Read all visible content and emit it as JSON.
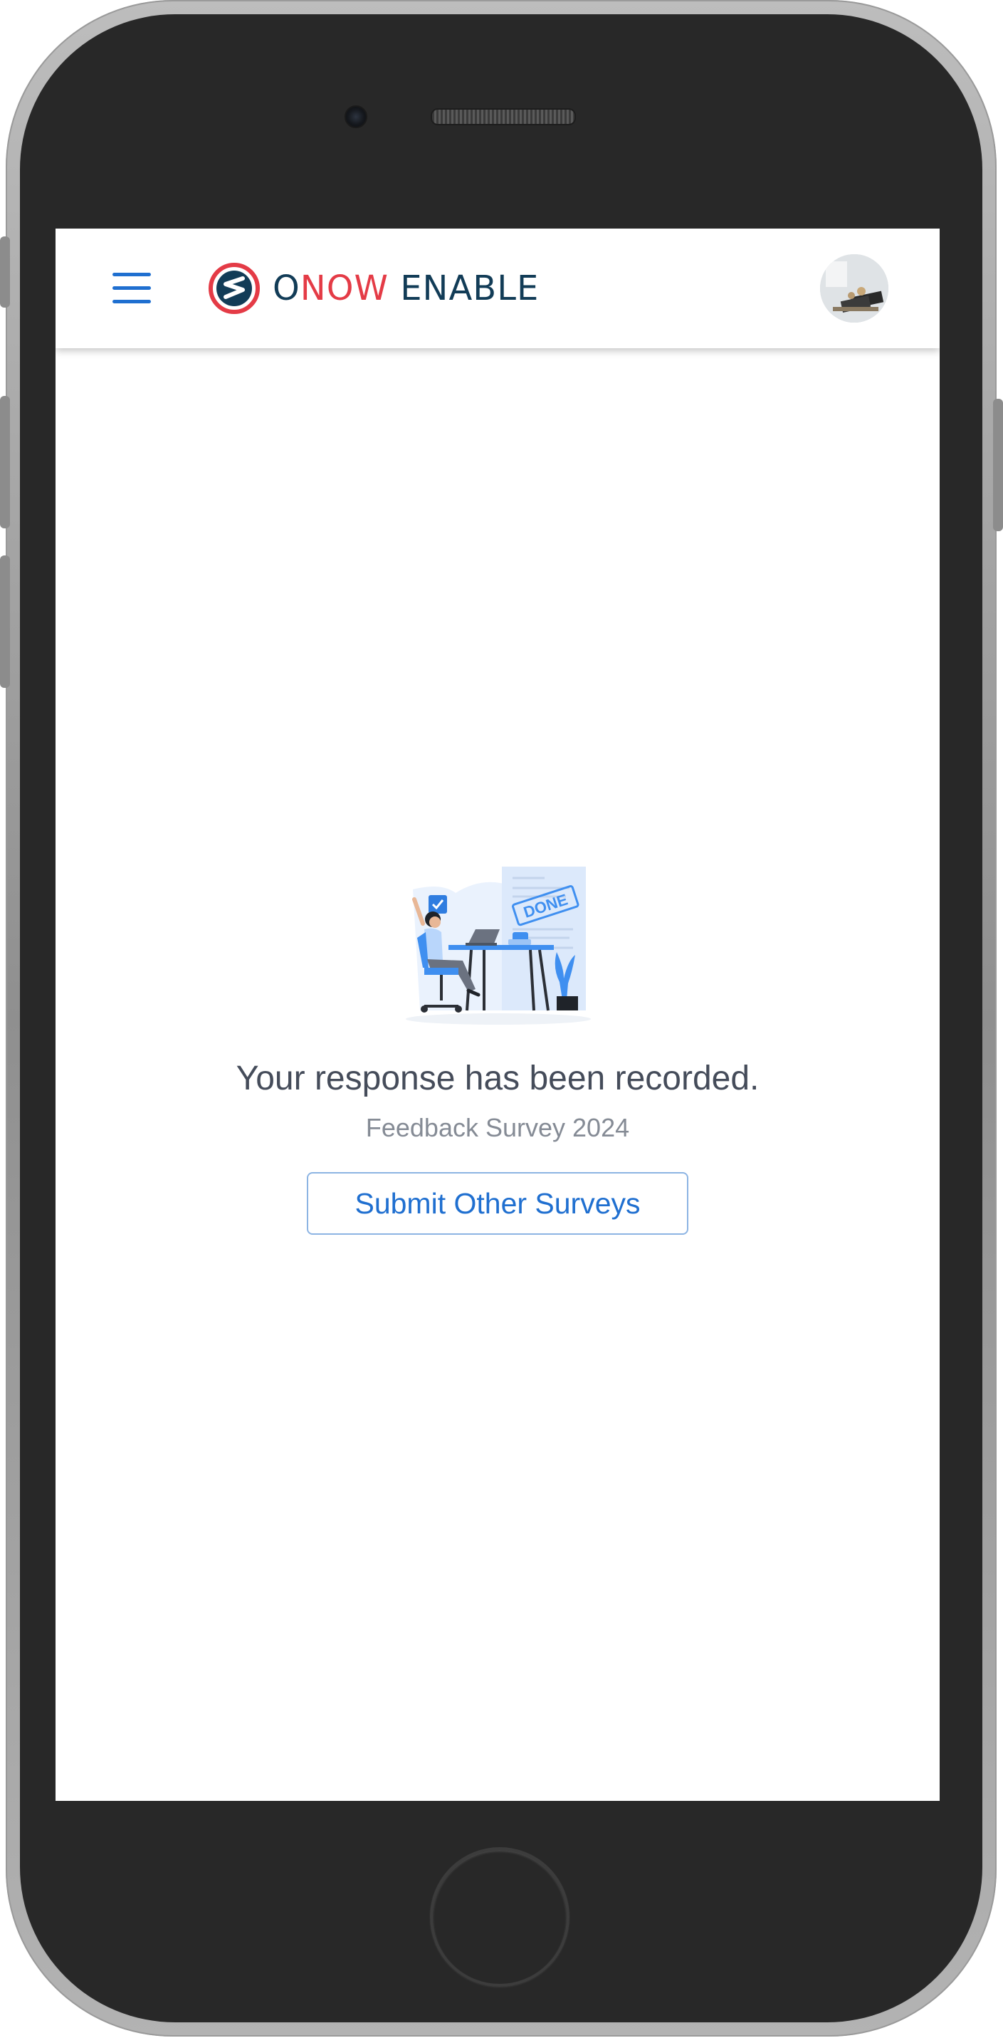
{
  "header": {
    "logo": {
      "part1": "O",
      "part2": "NOW",
      "part3": "ENABLE"
    },
    "colors": {
      "accent": "#1f6fd0",
      "logo_dark": "#123c57",
      "logo_red": "#e43b46"
    }
  },
  "illustration": {
    "stamp_text": "DONE"
  },
  "confirmation": {
    "headline": "Your response has been recorded.",
    "survey_name": "Feedback Survey 2024",
    "button_label": "Submit Other Surveys"
  }
}
